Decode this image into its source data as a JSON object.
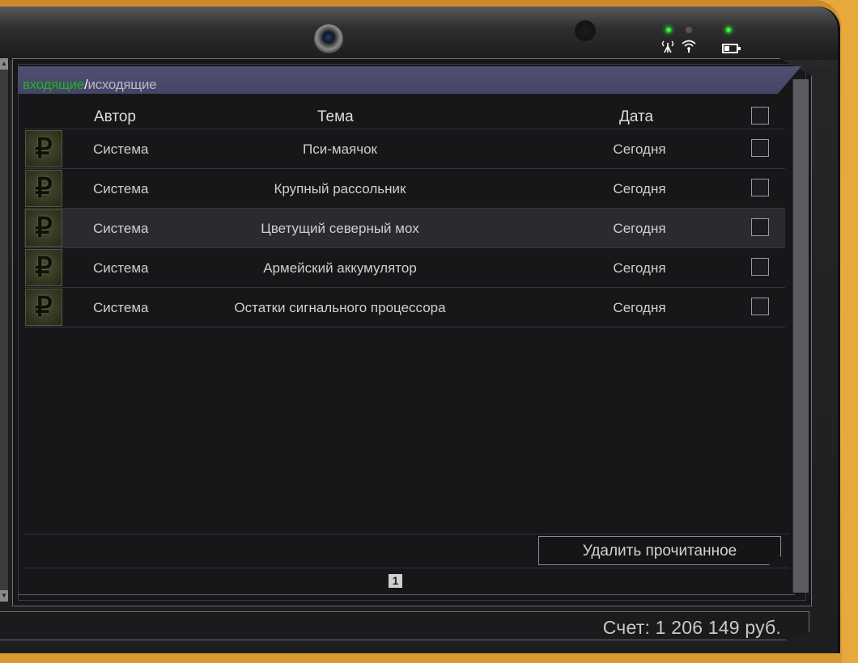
{
  "tabs": {
    "incoming": "входящие",
    "separator": "/",
    "outgoing": "исходящие",
    "active_color": "#1fb31f"
  },
  "columns": {
    "author": "Автор",
    "topic": "Тема",
    "date": "Дата"
  },
  "rows": [
    {
      "icon": "ruble-icon",
      "glyph": "₽",
      "author": "Система",
      "topic": "Пси-маячок",
      "date": "Сегодня"
    },
    {
      "icon": "ruble-icon",
      "glyph": "₽",
      "author": "Система",
      "topic": "Крупный рассольник",
      "date": "Сегодня"
    },
    {
      "icon": "ruble-icon",
      "glyph": "₽",
      "author": "Система",
      "topic": "Цветущий северный мох",
      "date": "Сегодня"
    },
    {
      "icon": "ruble-icon",
      "glyph": "₽",
      "author": "Система",
      "topic": "Армейский аккумулятор",
      "date": "Сегодня"
    },
    {
      "icon": "ruble-icon",
      "glyph": "₽",
      "author": "Система",
      "topic": "Остатки сигнального процессора",
      "date": "Сегодня"
    }
  ],
  "actions": {
    "delete_read": "Удалить прочитанное"
  },
  "pagination": {
    "current_page": "1"
  },
  "status": {
    "account": "Счет: 1 206 149 руб."
  },
  "indicators": {
    "signal_icon": "antenna-icon",
    "wifi_icon": "wifi-icon",
    "battery_icon": "battery-icon"
  }
}
